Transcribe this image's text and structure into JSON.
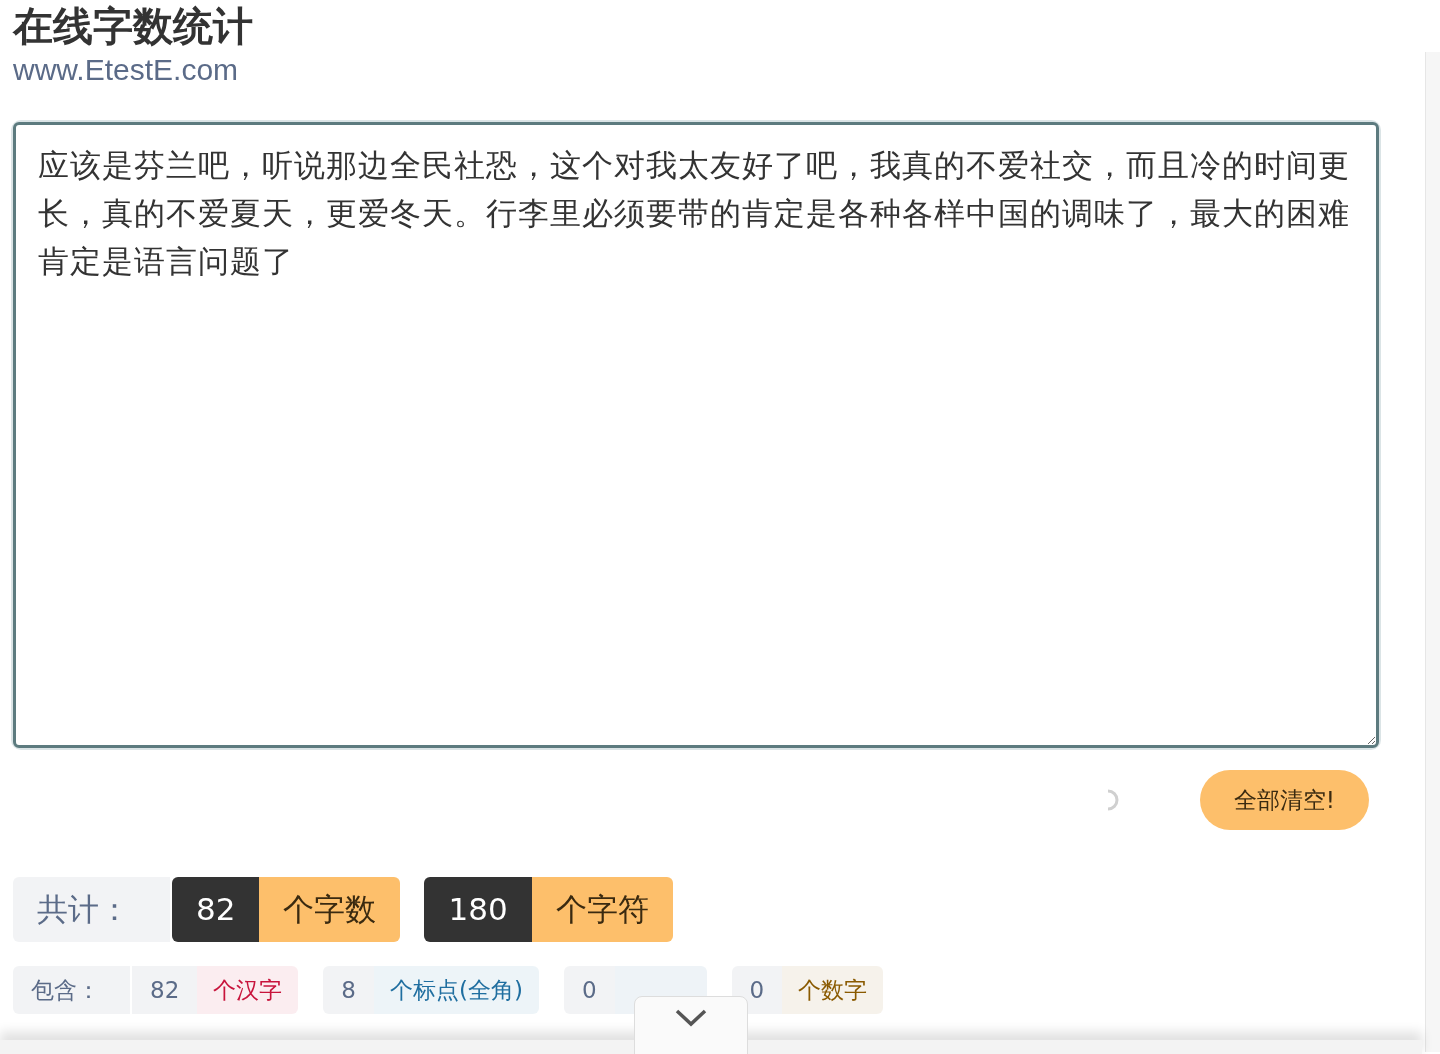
{
  "header": {
    "title": "在线字数统计",
    "site": "www.EtestE.com"
  },
  "editor": {
    "value": "应该是芬兰吧，听说那边全民社恐，这个对我太友好了吧，我真的不爱社交，而且冷的时间更长，真的不爱夏天，更爱冬天。行李里必须要带的肯定是各种各样中国的调味了，最大的困难肯定是语言问题了"
  },
  "clear_button": "全部清空!",
  "totals": {
    "label": "共计：",
    "items": [
      {
        "count": "82",
        "unit": "个字数"
      },
      {
        "count": "180",
        "unit": "个字符"
      }
    ]
  },
  "breakdown": {
    "label": "包含：",
    "items": [
      {
        "count": "82",
        "unit": "个汉字",
        "color": "#c8143c"
      },
      {
        "count": "8",
        "unit": "个标点(全角)",
        "color": "#1f6ea0"
      },
      {
        "count": "0"
      },
      {
        "count": "0",
        "unit": "个数字",
        "color": "#8a5a00"
      }
    ]
  }
}
